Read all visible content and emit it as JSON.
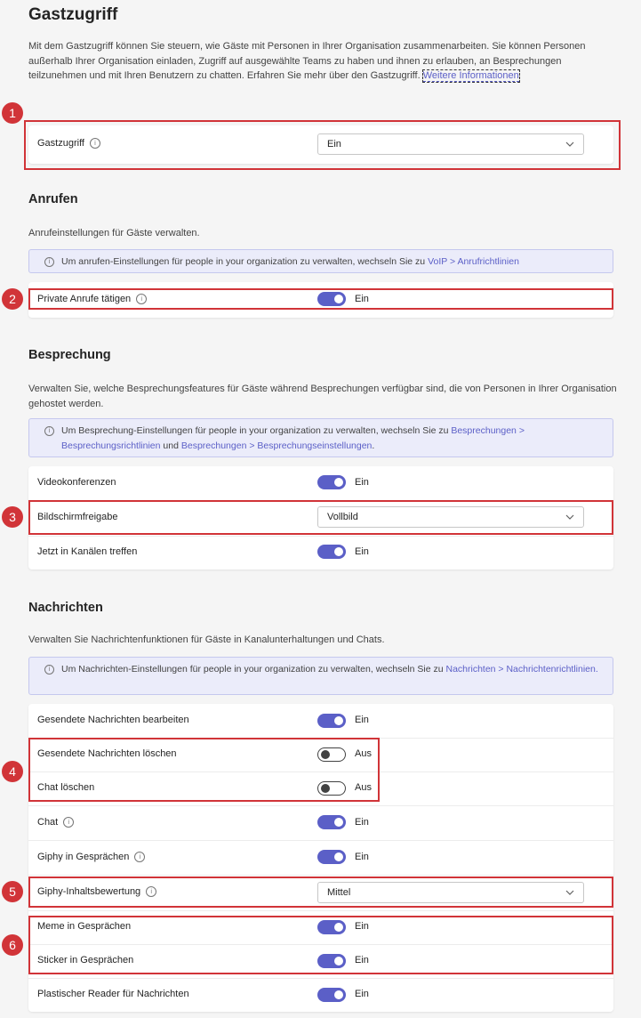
{
  "page": {
    "title": "Gastzugriff",
    "intro_text": "Mit dem Gastzugriff können Sie steuern, wie Gäste mit Personen in Ihrer Organisation zusammenarbeiten. Sie können Personen außerhalb Ihrer Organisation einladen, Zugriff auf ausgewählte Teams zu haben und ihnen zu erlauben, an Besprechungen teilzunehmen und mit Ihren Benutzern zu chatten. Erfahren Sie mehr über den Gastzugriff.",
    "intro_link": "Weitere Informationen"
  },
  "guest_access": {
    "label": "Gastzugriff",
    "value": "Ein"
  },
  "calls": {
    "heading": "Anrufen",
    "description": "Anrufeinstellungen für Gäste verwalten.",
    "note_text": "Um anrufen-Einstellungen für people in your organization zu verwalten, wechseln Sie zu",
    "note_link": "VoIP > Anrufrichtlinien",
    "private_calls": {
      "label": "Private Anrufe tätigen",
      "value": "Ein"
    }
  },
  "meeting": {
    "heading": "Besprechung",
    "description": "Verwalten Sie, welche Besprechungsfeatures für Gäste während Besprechungen verfügbar sind, die von Personen in Ihrer Organisation gehostet werden.",
    "note_text": "Um Besprechung-Einstellungen für people in your organization zu verwalten, wechseln Sie zu",
    "note_link1": "Besprechungen > Besprechungsrichtlinien",
    "note_and": "und",
    "note_link2": "Besprechungen > Besprechungseinstellungen",
    "video": {
      "label": "Videokonferenzen",
      "value": "Ein"
    },
    "screenshare": {
      "label": "Bildschirmfreigabe",
      "value": "Vollbild"
    },
    "meet_now": {
      "label": "Jetzt in Kanälen treffen",
      "value": "Ein"
    }
  },
  "messaging": {
    "heading": "Nachrichten",
    "description": "Verwalten Sie Nachrichtenfunktionen für Gäste in Kanalunterhaltungen und Chats.",
    "note_text": "Um Nachrichten-Einstellungen für people in your organization zu verwalten, wechseln Sie zu",
    "note_link": "Nachrichten > Nachrichtenrichtlinien.",
    "edit_sent": {
      "label": "Gesendete Nachrichten bearbeiten",
      "value": "Ein"
    },
    "delete_sent": {
      "label": "Gesendete Nachrichten löschen",
      "value": "Aus"
    },
    "delete_chat": {
      "label": "Chat löschen",
      "value": "Aus"
    },
    "chat": {
      "label": "Chat",
      "value": "Ein"
    },
    "giphy": {
      "label": "Giphy in Gesprächen",
      "value": "Ein"
    },
    "giphy_rating": {
      "label": "Giphy-Inhaltsbewertung",
      "value": "Mittel"
    },
    "memes": {
      "label": "Meme in Gesprächen",
      "value": "Ein"
    },
    "stickers": {
      "label": "Sticker in Gesprächen",
      "value": "Ein"
    },
    "immersive_reader": {
      "label": "Plastischer Reader für Nachrichten",
      "value": "Ein"
    }
  },
  "badges": [
    "1",
    "2",
    "3",
    "4",
    "5",
    "6"
  ],
  "colors": {
    "accent": "#5b5fc7",
    "highlight": "#d13438",
    "note_bg": "#ebecfa"
  },
  "icons": {
    "info": "info-icon",
    "dropdown": "chevron-down-icon"
  }
}
